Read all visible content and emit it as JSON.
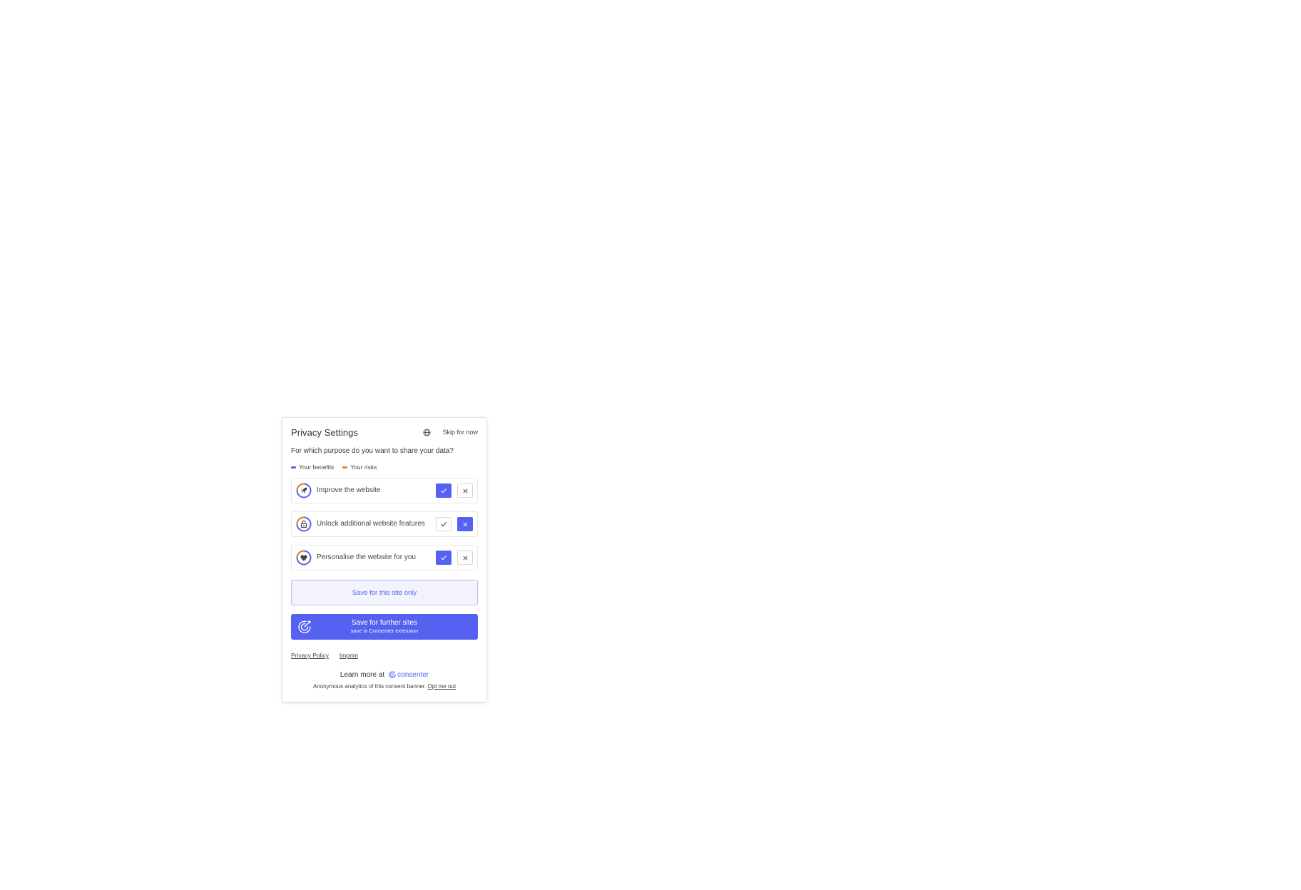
{
  "banner": {
    "title": "Privacy Settings",
    "language_icon": "globe-icon",
    "skip_label": "Skip for now",
    "question": "For which purpose do you want to share your data?"
  },
  "legend": {
    "benefits_label": "Your benefits",
    "risks_label": "Your risks",
    "benefits_color": "#5561f0",
    "risks_color": "#f07b2a"
  },
  "purposes": [
    {
      "label": "Improve the website",
      "icon": "rocket-icon",
      "accepted": true
    },
    {
      "label": "Unlock additional website features",
      "icon": "unlock-icon",
      "accepted": false
    },
    {
      "label": "Personalise the website for you",
      "icon": "heart-icon",
      "accepted": true
    }
  ],
  "actions": {
    "save_site_label": "Save for this site only",
    "save_further_label": "Save for further sites",
    "save_further_sublabel": "save in Consenter extension"
  },
  "footer": {
    "privacy_policy_label": "Privacy Policy",
    "imprint_label": "Imprint",
    "learn_more_label": "Learn more at",
    "brand_name": "consenter",
    "analytics_text": "Anonymous analytics of this consent banner.",
    "opt_out_label": "Opt me out"
  },
  "colors": {
    "accent": "#5561f0",
    "risk": "#f07b2a",
    "text": "#333333"
  }
}
